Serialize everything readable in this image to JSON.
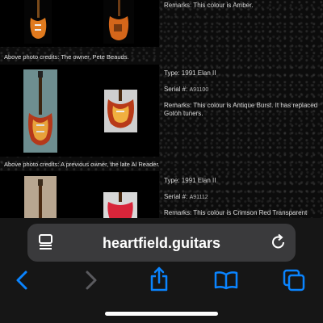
{
  "entries": [
    {
      "remarks": "Remarks: This colour is Amber.",
      "credit": "Above photo credits: The owner, Pete Beauds."
    },
    {
      "type": "Type: 1991 Elan II",
      "serial_label": "Serial #:",
      "serial_value": "A91100",
      "remarks_line1": "Remarks: This colour is Antique Burst. It has replaced",
      "remarks_line2": "Gotoh tuners.",
      "credit": "Above photo credits: A previous owner, the late Al Reader."
    },
    {
      "type": "Type: 1991 Elan II",
      "serial_label": "Serial #:",
      "serial_value": "A91112",
      "remarks_line1": "Remarks: This colour is Crimson Red Transparent"
    }
  ],
  "browser": {
    "url": "heartfield.guitars",
    "icons": {
      "reader": "reader-mode-icon",
      "reload": "reload-icon",
      "back": "back-chevron-icon",
      "forward": "forward-chevron-icon",
      "share": "share-icon",
      "bookmarks": "bookmarks-icon",
      "tabs": "tabs-icon"
    },
    "accent_color": "#0a84ff"
  }
}
